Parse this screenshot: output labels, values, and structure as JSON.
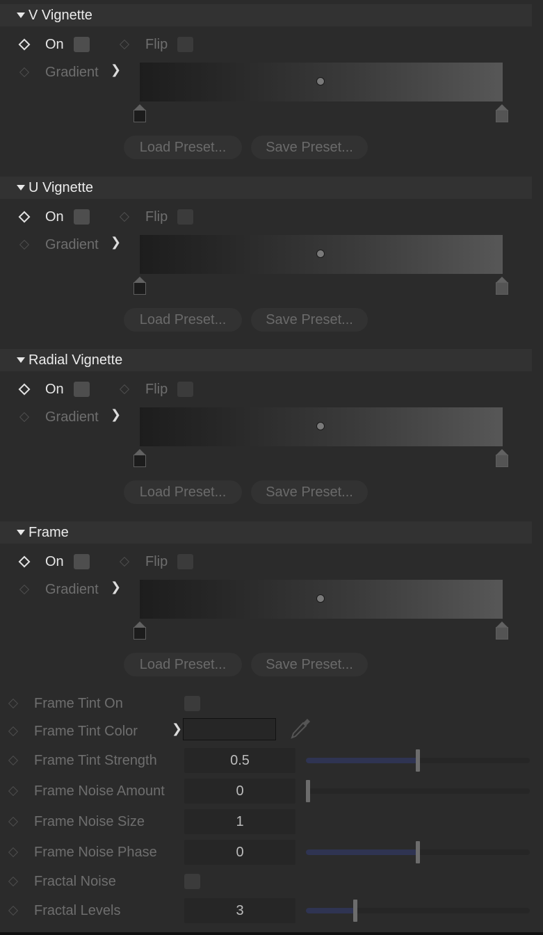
{
  "sections": [
    {
      "title": "V Vignette",
      "on_label": "On",
      "flip_label": "Flip",
      "gradient_label": "Gradient",
      "load_preset": "Load Preset...",
      "save_preset": "Save Preset..."
    },
    {
      "title": "U Vignette",
      "on_label": "On",
      "flip_label": "Flip",
      "gradient_label": "Gradient",
      "load_preset": "Load Preset...",
      "save_preset": "Save Preset..."
    },
    {
      "title": "Radial Vignette",
      "on_label": "On",
      "flip_label": "Flip",
      "gradient_label": "Gradient",
      "load_preset": "Load Preset...",
      "save_preset": "Save Preset..."
    },
    {
      "title": "Frame",
      "on_label": "On",
      "flip_label": "Flip",
      "gradient_label": "Gradient",
      "load_preset": "Load Preset...",
      "save_preset": "Save Preset..."
    }
  ],
  "frame_props": {
    "tint_on": {
      "label": "Frame Tint On"
    },
    "tint_color": {
      "label": "Frame Tint Color"
    },
    "tint_strength": {
      "label": "Frame Tint Strength",
      "value": "0.5",
      "slider_fraction": 0.5
    },
    "noise_amount": {
      "label": "Frame Noise Amount",
      "value": "0",
      "slider_fraction": 0.0
    },
    "noise_size": {
      "label": "Frame Noise Size",
      "value": "1"
    },
    "noise_phase": {
      "label": "Frame Noise Phase",
      "value": "0",
      "slider_fraction": 0.5
    },
    "fractal_noise": {
      "label": "Fractal Noise"
    },
    "fractal_levels": {
      "label": "Fractal Levels",
      "value": "3",
      "slider_fraction": 0.22
    }
  },
  "colors": {
    "panel_bg": "#2b2b2b",
    "header_bg": "#323232",
    "slider_fill": "#2f3452",
    "text_bright": "#e6e6e6",
    "text_dim": "#6e6e6e"
  },
  "icons": {
    "keyframe": "diamond-icon",
    "expand": "chevron-right-icon",
    "collapse": "triangle-down-icon",
    "color_picker": "eyedropper-icon"
  }
}
